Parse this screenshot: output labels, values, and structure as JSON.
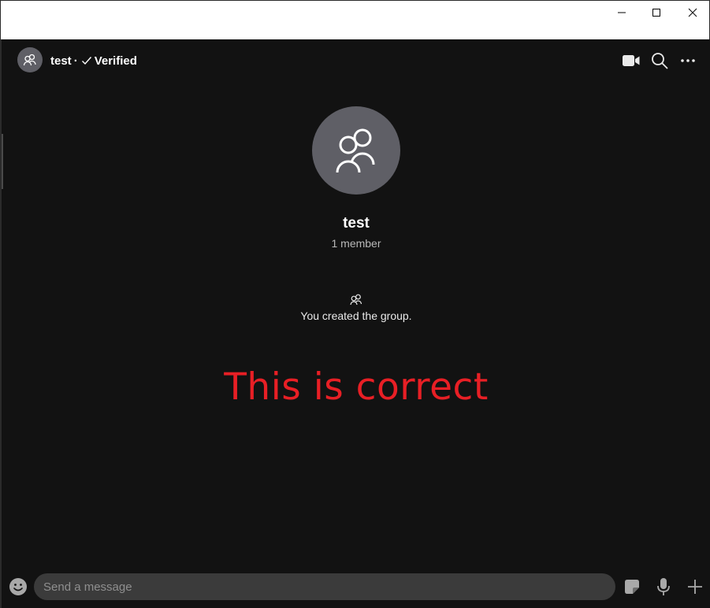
{
  "window": {
    "minimize_icon": "minimize-icon",
    "maximize_icon": "maximize-icon",
    "close_icon": "close-icon"
  },
  "header": {
    "title": "test",
    "separator": "·",
    "verified_label": "Verified",
    "icons": [
      "group-icon",
      "checkmark-icon",
      "video-call-icon",
      "search-icon",
      "more-icon"
    ]
  },
  "hero": {
    "name": "test",
    "member_count": "1 member",
    "avatar_icon": "group-icon"
  },
  "system_message": {
    "text": "You created the group.",
    "icon": "group-icon"
  },
  "annotation": {
    "text": "This is correct",
    "color": "#e81f25"
  },
  "composer": {
    "placeholder": "Send a message",
    "value": "",
    "icons": [
      "emoji-icon",
      "sticker-icon",
      "microphone-icon",
      "plus-icon"
    ]
  },
  "colors": {
    "background": "#121212",
    "avatar_bg": "#5f5f66",
    "input_bg": "#3b3b3b",
    "text_primary": "#ffffff",
    "text_secondary": "#b9b9b9"
  }
}
